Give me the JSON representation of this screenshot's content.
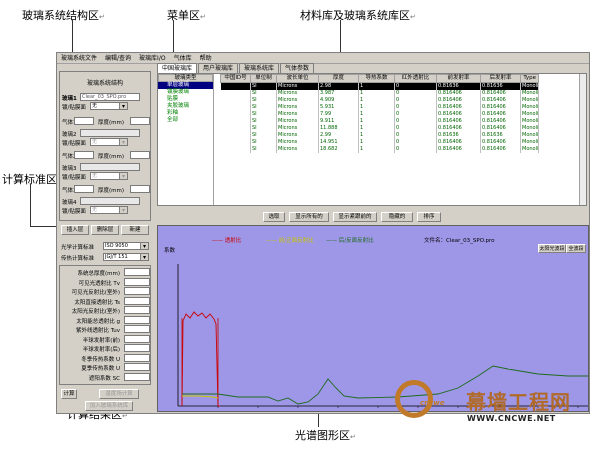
{
  "callouts": {
    "glass_structure": "玻璃系统结构区",
    "menu": "菜单区",
    "library": "材料库及玻璃系统库区",
    "calc_standard": "计算标准区",
    "calc_result": "计算结果区",
    "spectrum": "光谱图形区",
    "return_mark": "↵"
  },
  "menubar": [
    "玻璃系统文件",
    "编辑/查询",
    "玻璃库I/O",
    "气体库",
    "帮助"
  ],
  "structure": {
    "title": "玻璃系统结构",
    "glass1_label": "玻璃1",
    "glass1_value": "Clear_03_SPO.pro",
    "film_label": "镀/贴膜面",
    "film_value": "无",
    "gas1_label": "气体1",
    "thickness_label": "厚度(mm)",
    "glass2_label": "玻璃2",
    "gas2_label": "气体2",
    "glass3_label": "玻璃3",
    "gas3_label": "气体3",
    "glass4_label": "玻璃4",
    "insert_btn": "插入层",
    "delete_btn": "删除层",
    "new_btn": "新建"
  },
  "standards": {
    "optical_label": "光学计算标准",
    "optical_value": "ISO 9050",
    "thermal_label": "传热计算标准",
    "thermal_value": "JGJ/T 151"
  },
  "results": {
    "rows": [
      "系统总厚度(mm)",
      "可见光透射比 Tv",
      "可见光反射比(室外)",
      "太阳直接透射比 Ts",
      "太阳光反射比(室外)",
      "太阳能总透射比 g",
      "紫外线透射比 Tuv",
      "半球发射率(前)",
      "半球发射率(后)",
      "冬季传热系数 U",
      "夏季传热系数 U",
      "遮阳系数 SC"
    ],
    "calc_btn": "计算",
    "temp_btn": "温度场计算",
    "add_btn": "加入玻璃系统库"
  },
  "library": {
    "tabs": [
      "中国玻璃库",
      "用户玻璃库",
      "玻璃系统库",
      "气体参数"
    ],
    "category_header": "玻璃类型",
    "categories": [
      "单层玻璃",
      "镀膜玻璃",
      "贴膜",
      "夹胶玻璃",
      "彩釉",
      "全部"
    ],
    "columns": [
      "中国ID号",
      "单位制",
      "波长单位",
      "厚度",
      "导热系数",
      "红外透射比",
      "前发射率",
      "后发射率",
      "Type"
    ],
    "rows": [
      [
        "",
        "SI",
        "Microns",
        "2.98",
        "1",
        "0",
        "0.81636",
        "0.81636",
        "Monoli"
      ],
      [
        "",
        "SI",
        "Microns",
        "3.987",
        "1",
        "0",
        "0.816406",
        "0.816406",
        "Monoli"
      ],
      [
        "",
        "SI",
        "Microns",
        "4.909",
        "1",
        "0",
        "0.816406",
        "0.816406",
        "Monoli"
      ],
      [
        "",
        "SI",
        "Microns",
        "5.931",
        "1",
        "0",
        "0.816406",
        "0.816406",
        "Monoli"
      ],
      [
        "",
        "SI",
        "Microns",
        "7.99",
        "1",
        "0",
        "0.816406",
        "0.816406",
        "Monoli"
      ],
      [
        "",
        "SI",
        "Microns",
        "9.911",
        "1",
        "0",
        "0.816406",
        "0.816406",
        "Monoli"
      ],
      [
        "",
        "SI",
        "Microns",
        "11.888",
        "1",
        "0",
        "0.816406",
        "0.816406",
        "Monoli"
      ],
      [
        "",
        "SI",
        "Microns",
        "2.99",
        "1",
        "0",
        "0.81636",
        "0.81636",
        "Monoli"
      ],
      [
        "",
        "SI",
        "Microns",
        "14.951",
        "1",
        "0",
        "0.816406",
        "0.816406",
        "Monoli"
      ],
      [
        "",
        "SI",
        "Microns",
        "18.682",
        "1",
        "0",
        "0.816406",
        "0.816406",
        "Monoli"
      ]
    ],
    "toolbar": [
      "选取",
      "显示所有的",
      "显示紧跟前的",
      "隐藏的",
      "排序"
    ]
  },
  "chart": {
    "legend_trans": "透射比",
    "legend_front": "前/正面反射比",
    "legend_back": "后/反面反射比",
    "ylabel": "系数",
    "filename": "文件名：Clear_03_SPO.pro",
    "btn_sun": "太阳光波段",
    "btn_all": "全波段",
    "colors": {
      "trans": "#cc0000",
      "front": "#c8c800",
      "back": "#2e8b2e",
      "bg": "#9e96e6"
    }
  },
  "watermark": {
    "text": "幕墙工程网",
    "url": "WWW.CNCWE.NET",
    "logo_sub": "cncwe"
  }
}
